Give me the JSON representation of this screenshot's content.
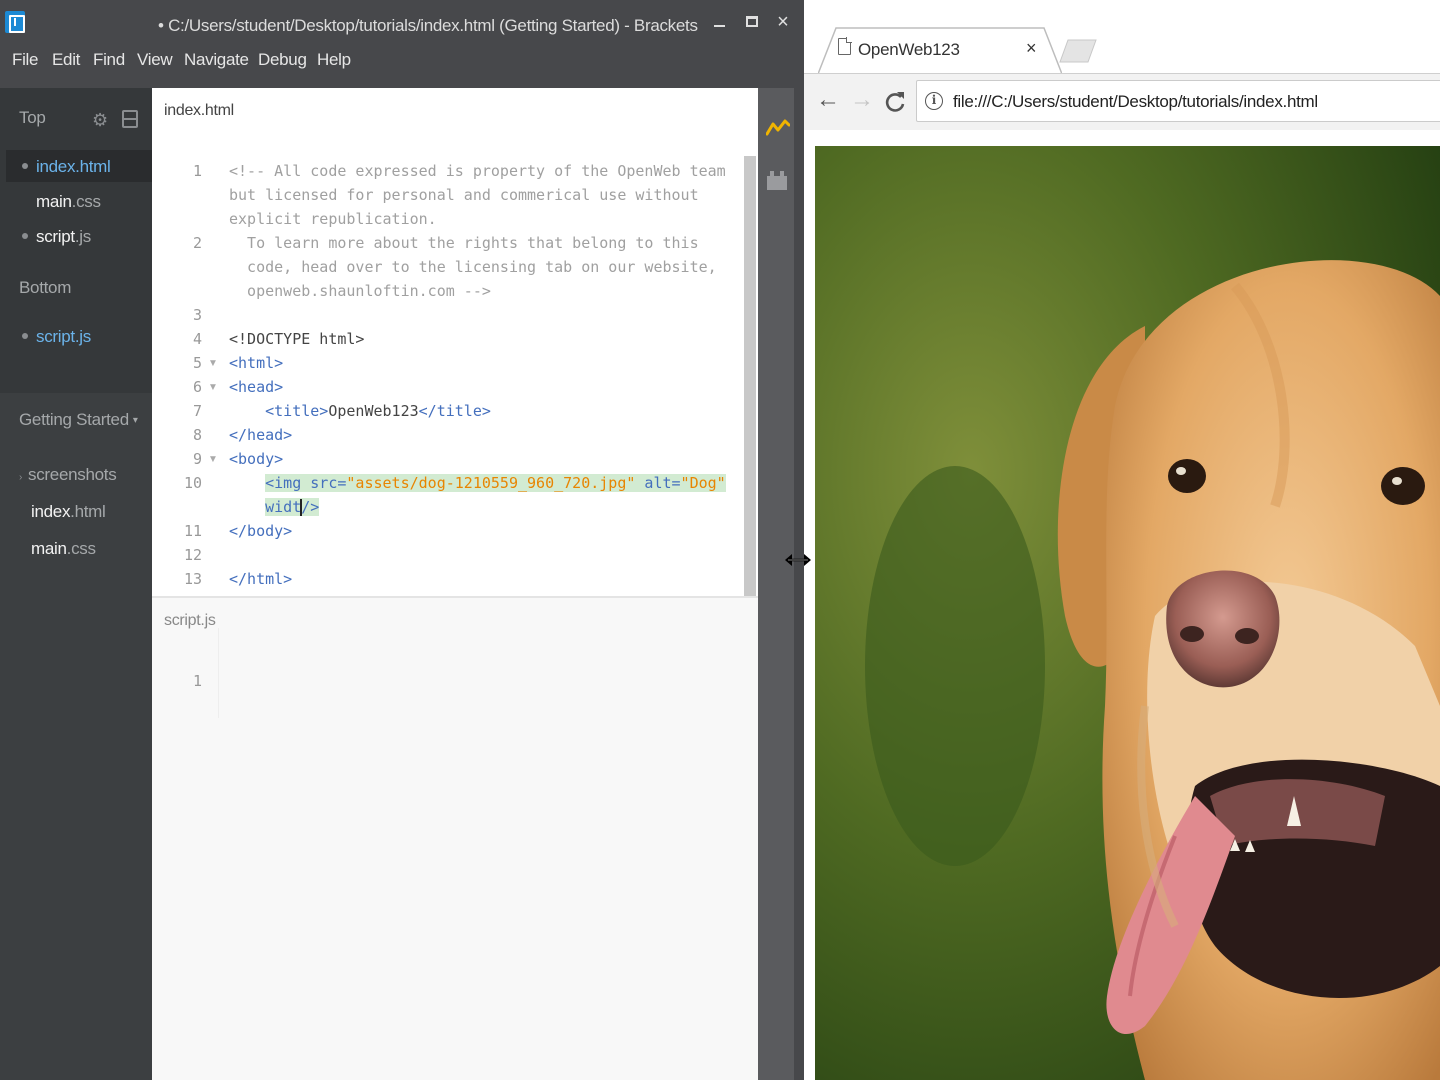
{
  "brackets": {
    "title": "• C:/Users/student/Desktop/tutorials/index.html (Getting Started) - Brackets",
    "menu": [
      "File",
      "Edit",
      "Find",
      "View",
      "Navigate",
      "Debug",
      "Help"
    ],
    "close_symbol": "×"
  },
  "sidebar": {
    "top_label": "Top",
    "working_top": [
      {
        "name": "index",
        "ext": ".html"
      },
      {
        "name": "main",
        "ext": ".css"
      },
      {
        "name": "script",
        "ext": ".js"
      }
    ],
    "bottom_label": "Bottom",
    "working_bottom": [
      {
        "name": "script",
        "ext": ".js"
      }
    ],
    "project_name": "Getting Started",
    "tree": [
      {
        "name": "screenshots",
        "ext": ""
      },
      {
        "name": "index",
        "ext": ".html"
      },
      {
        "name": "main",
        "ext": ".css"
      }
    ]
  },
  "editor": {
    "top_file": "index.html",
    "bottom_file": "script.js",
    "line_numbers": [
      "1",
      "2",
      "3",
      "4",
      "5",
      "6",
      "7",
      "8",
      "9",
      "10",
      "11",
      "12",
      "13"
    ],
    "lines": {
      "l1a": "<!-- All code expressed is property of the OpenWeb team",
      "l1b": "but licensed for personal and commerical use without",
      "l1c": "explicit republication.",
      "l2a": "  To learn more about the rights that belong to this",
      "l2b": "  code, head over to the licensing tab on our website,",
      "l2c": "  openweb.shaunloftin.com -->",
      "l4": "<!DOCTYPE html>",
      "l5": "<html>",
      "l6": "<head>",
      "l7_open": "<title>",
      "l7_text": "OpenWeb123",
      "l7_close": "</title>",
      "l8": "</head>",
      "l9": "<body>",
      "l10_tag": "<img",
      "l10_src_attr": "src=",
      "l10_src_val": "\"assets/dog-1210559_960_720.jpg\"",
      "l10_alt_attr": "alt=",
      "l10_alt_val": "\"Dog\"",
      "l10b_attr": "widt",
      "l10b_close": "/>",
      "l11": "</body>",
      "l13": "</html>"
    },
    "bottom_line_number": "1"
  },
  "chrome": {
    "tab_title": "OpenWeb123",
    "tab_close": "×",
    "url": "file:///C:/Users/student/Desktop/tutorials/index.html",
    "back": "←",
    "forward": "→",
    "reload": "C",
    "info": "i"
  },
  "colors": {
    "brackets_chrome": "#47484b",
    "sidebar": "#3c3f41",
    "selection": "#6bb3ea",
    "highlight": "#d2ebd2",
    "string": "#e88501",
    "tag": "#446fbd"
  }
}
